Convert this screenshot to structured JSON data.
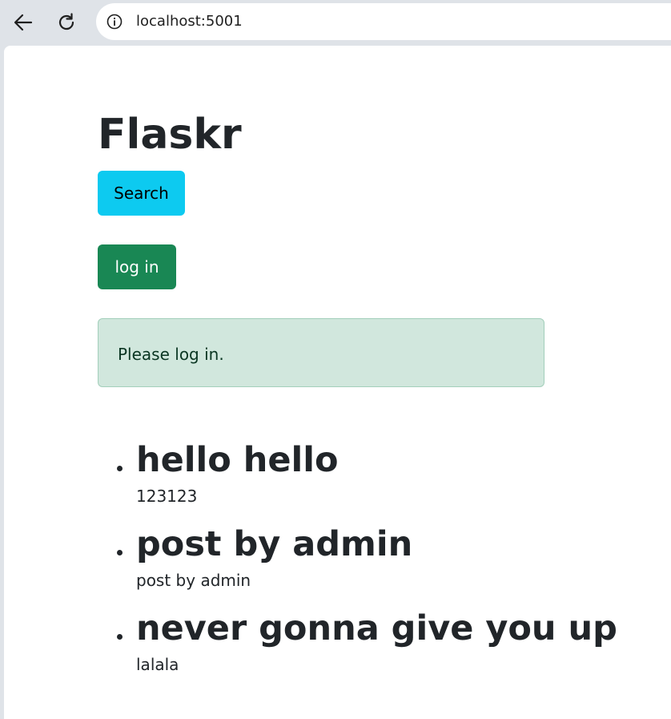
{
  "browser": {
    "url": "localhost:5001",
    "back_icon": "back-arrow-icon",
    "reload_icon": "reload-icon",
    "info_icon": "info-icon"
  },
  "app": {
    "title": "Flaskr",
    "search_label": "Search",
    "login_label": "log in",
    "flash_message": "Please log in."
  },
  "posts": [
    {
      "title": "hello hello",
      "body": "123123"
    },
    {
      "title": "post by admin",
      "body": "post by admin"
    },
    {
      "title": "never gonna give you up",
      "body": "lalala"
    }
  ],
  "colors": {
    "search_button": "#0dcaf0",
    "login_button": "#198754",
    "alert_background": "#d1e7dd",
    "alert_border": "#a3cfbb",
    "alert_text": "#0a3622",
    "text": "#212529"
  }
}
